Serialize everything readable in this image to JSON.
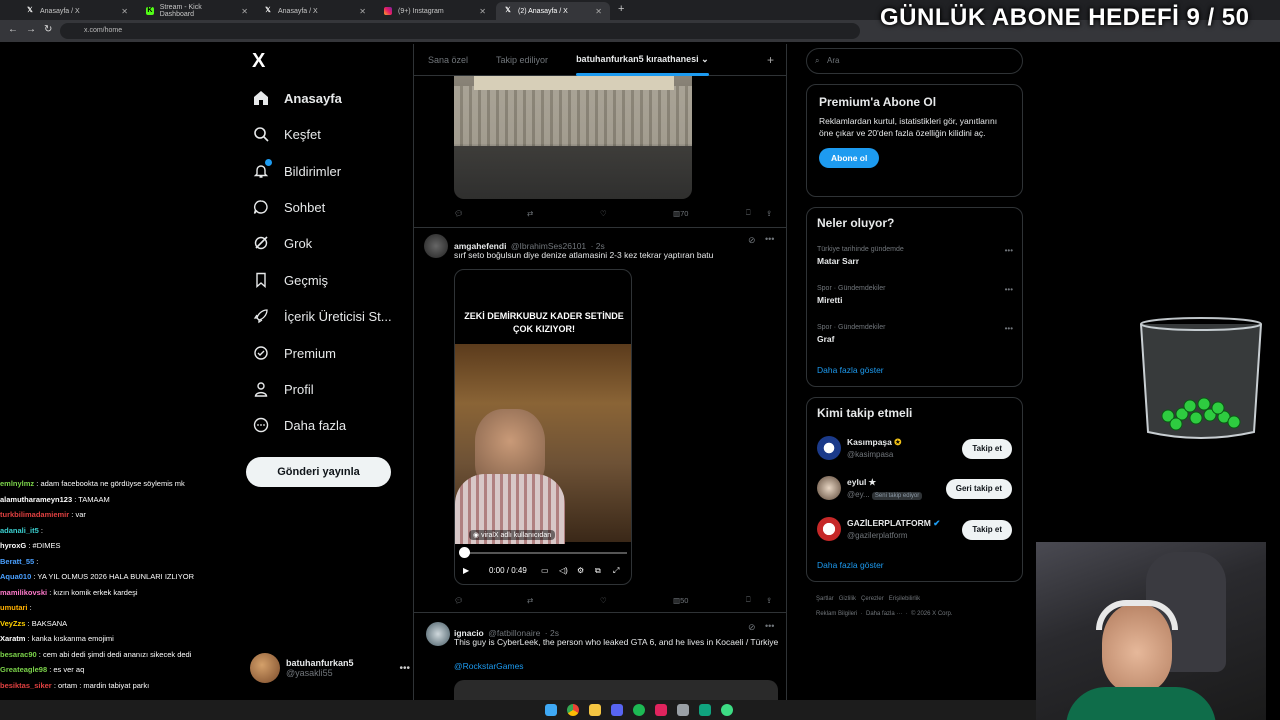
{
  "browser": {
    "tabs": [
      {
        "label": "Anasayfa / X",
        "favicon": "x-icon"
      },
      {
        "label": "Stream - Kick Dashboard",
        "favicon": "kick-icon"
      },
      {
        "label": "Anasayfa / X",
        "favicon": "x-icon"
      },
      {
        "label": "(9+) Instagram",
        "favicon": "instagram-icon"
      },
      {
        "label": "(2) Anasayfa / X",
        "favicon": "x-icon"
      }
    ],
    "url": "x.com/home"
  },
  "overlay": {
    "goal_text": "GÜNLÜK ABONE HEDEFİ 9 / 50"
  },
  "nav": {
    "logo": "X",
    "items": [
      {
        "label": "Anasayfa",
        "icon": "home-icon"
      },
      {
        "label": "Keşfet",
        "icon": "search-icon"
      },
      {
        "label": "Bildirimler",
        "icon": "bell-icon"
      },
      {
        "label": "Sohbet",
        "icon": "chat-icon"
      },
      {
        "label": "Grok",
        "icon": "grok-icon"
      },
      {
        "label": "Geçmiş",
        "icon": "bookmark-icon"
      },
      {
        "label": "İçerik Üreticisi St...",
        "icon": "rocket-icon"
      },
      {
        "label": "Premium",
        "icon": "premium-icon"
      },
      {
        "label": "Profil",
        "icon": "person-icon"
      },
      {
        "label": "Daha fazla",
        "icon": "more-circle-icon"
      }
    ],
    "post_button": "Gönderi yayınla",
    "profile": {
      "name": "batuhanfurkan5",
      "handle": "@yasakli55"
    }
  },
  "chat": [
    {
      "user": "emlnylmz",
      "color": "#7bd34a",
      "msg": ": adam facebookta ne gördüyse söylemis mk"
    },
    {
      "user": "alamutharameyn123",
      "color": "#ffffff",
      "msg": ": TAMAAM"
    },
    {
      "user": "turkbilimadamiemir",
      "color": "#e04040",
      "msg": ": var"
    },
    {
      "user": "adanali_it5",
      "color": "#3bd0d0",
      "msg": ":"
    },
    {
      "user": "hyroxG",
      "color": "#ffffff",
      "msg": ": #DIMES"
    },
    {
      "user": "Beratt_55",
      "color": "#4aa0ff",
      "msg": ":"
    },
    {
      "user": "Aqua010",
      "color": "#4aa0ff",
      "msg": ": YA YIL OLMUS 2026 HALA BUNLARI IZLIYOR"
    },
    {
      "user": "mamilikovski",
      "color": "#ff7acb",
      "msg": ": kızın komik erkek kardeşi"
    },
    {
      "user": "umutari",
      "color": "#ffb000",
      "msg": ":"
    },
    {
      "user": "VeyZzs",
      "color": "#ffd000",
      "msg": ": BAKSANA"
    },
    {
      "user": "Xaratm",
      "color": "#ffffff",
      "msg": ": kanka kıskanma emojimi"
    },
    {
      "user": "besarac90",
      "color": "#7bd34a",
      "msg": ": cem abi dedi şimdi dedi ananızı sikecek dedi"
    },
    {
      "user": "Greateagle98",
      "color": "#7bd34a",
      "msg": ": es ver aq"
    },
    {
      "user": "besiktas_siker",
      "color": "#e04040",
      "msg": ": ortam : mardin tabiyat parkı"
    }
  ],
  "feed": {
    "tabs": [
      "Sana özel",
      "Takip ediliyor",
      "batuhanfurkan5 kıraathanesi"
    ],
    "tweet1_actions": {
      "views": "70"
    },
    "tweet2": {
      "name": "amgahefendi",
      "handle": "@IbrahimSes26101",
      "time": "· 2s",
      "text": "sırf seto boğulsun diye denize atlamasini 2-3 kez tekrar yaptıran batu",
      "video_caption": "ZEKİ DEMİRKUBUZ KADER SETİNDE ÇOK KIZIYOR!",
      "watermark": "viralX adlı kullanıcıdan",
      "time_display": "0:00 / 0:49",
      "views": "50"
    },
    "tweet3": {
      "name": "ignacio",
      "handle": "@fatbillonaire",
      "time": "· 2s",
      "text": "This guy is CyberLeek, the person who leaked GTA 6, and he lives in Kocaeli / Türkiye",
      "mention": "@RockstarGames"
    }
  },
  "right": {
    "search_placeholder": "Ara",
    "premium": {
      "title": "Premium'a Abone Ol",
      "text": "Reklamlardan kurtul, istatistikleri gör, yanıtlarını öne çıkar ve 20'den fazla özelliğin kilidini aç.",
      "button": "Abone ol"
    },
    "trends": {
      "title": "Neler oluyor?",
      "items": [
        {
          "meta": "Türkiye tarihinde gündemde",
          "name": "Matar Sarr"
        },
        {
          "meta": "Spor · Gündemdekiler",
          "name": "Miretti"
        },
        {
          "meta": "Spor · Gündemdekiler",
          "name": "Graf"
        }
      ],
      "more": "Daha fazla göster"
    },
    "who_to_follow": {
      "title": "Kimi takip etmeli",
      "items": [
        {
          "name": "Kasımpaşa",
          "handle": "@kasimpasa",
          "button": "Takip et",
          "badge": ""
        },
        {
          "name": "eylul",
          "handle": "@ey...",
          "button": "Geri takip et",
          "badge": "Seni takip ediyor"
        },
        {
          "name": "GAZİLERPLATFORM",
          "handle": "@gazilerplatform",
          "button": "Takip et",
          "badge": ""
        }
      ],
      "more": "Daha fazla göster"
    },
    "footer": {
      "line1": [
        "Şartlar",
        "Gizlilik",
        "Çerezler",
        "Erişilebilirlik"
      ],
      "line2": [
        "Reklam Bilgileri",
        "Daha fazla ···",
        "© 2026 X Corp."
      ]
    }
  },
  "colors": {
    "accent": "#1d9bf0",
    "background": "#000000",
    "border": "#2f3336",
    "muted": "#71767b"
  }
}
